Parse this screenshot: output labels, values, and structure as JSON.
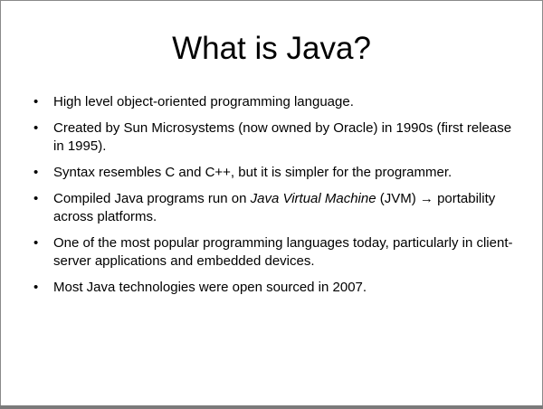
{
  "slide": {
    "title": "What is Java?",
    "bullets": [
      {
        "marker": "•",
        "text": "High level object-oriented programming language."
      },
      {
        "marker": "•",
        "text": "Created by Sun Microsystems (now owned by Oracle) in 1990s (first release in 1995)."
      },
      {
        "marker": "•",
        "text": "Syntax resembles C and C++, but it is simpler for the programmer."
      },
      {
        "marker": "•",
        "text_before": "Compiled Java programs run on ",
        "text_italic": "Java Virtual Machine",
        "text_after": " (JVM) → portability across platforms."
      },
      {
        "marker": "•",
        "text": "One of the most popular programming languages today, particularly in client-server applications and embedded devices."
      },
      {
        "marker": "•",
        "text": "Most Java technologies were open sourced in 2007."
      }
    ]
  }
}
